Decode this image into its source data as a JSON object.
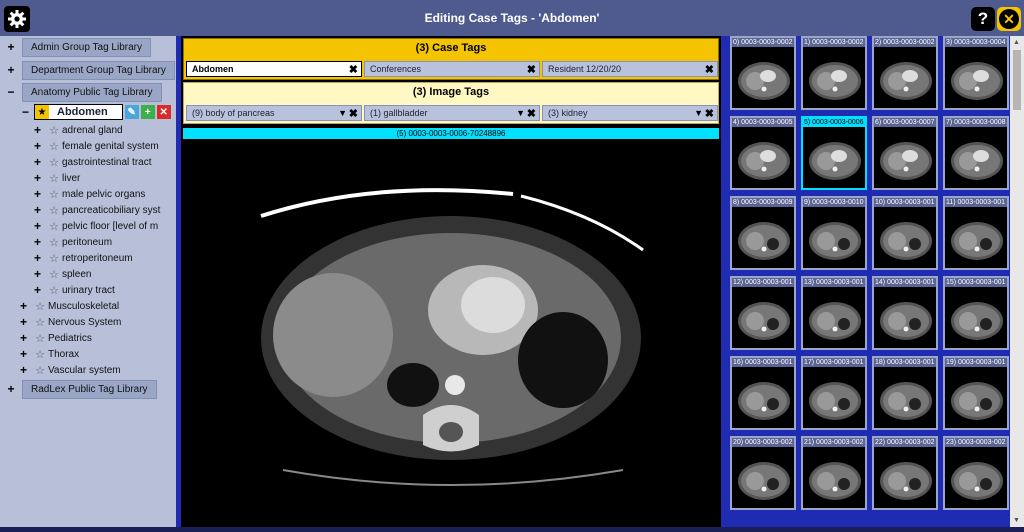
{
  "window": {
    "title": "Editing Case Tags - 'Abdomen'",
    "help_label": "?",
    "close_label": "✕"
  },
  "sidebar": {
    "libraries": [
      {
        "label": "Admin Group Tag Library",
        "toggle": "+"
      },
      {
        "label": "Department Group Tag Library",
        "toggle": "+"
      },
      {
        "label": "Anatomy Public Tag Library",
        "toggle": "−"
      },
      {
        "label": "RadLex Public Tag Library",
        "toggle": "+"
      }
    ],
    "selected_node": "Abdomen",
    "abdomen_children": [
      "adrenal gland",
      "female genital system",
      "gastrointestinal tract",
      "liver",
      "male pelvic organs",
      "pancreaticobiliary syst",
      "pelvic floor [level of m",
      "peritoneum",
      "retroperitoneum",
      "spleen",
      "urinary tract"
    ],
    "top_nodes": [
      "Musculoskeletal",
      "Nervous System",
      "Pediatrics",
      "Thorax",
      "Vascular system"
    ]
  },
  "case_tags": {
    "title": "(3) Case Tags",
    "tags": [
      "Abdomen",
      "Conferences",
      "Resident 12/20/20"
    ]
  },
  "image_tags": {
    "title": "(3) Image Tags",
    "tags": [
      "(9) body of pancreas",
      "(1) gallbladder",
      "(3) kidney"
    ]
  },
  "viewer": {
    "caption": "(5) 0003-0003-0006-70248896"
  },
  "thumbnails": {
    "selected_index": 5,
    "labels": [
      "0) 0003-0003-0002",
      "1) 0003-0003-0002",
      "2) 0003-0003-0002",
      "3) 0003-0003-0004",
      "4) 0003-0003-0005",
      "5) 0003-0003-0006",
      "6) 0003-0003-0007",
      "7) 0003-0003-0008",
      "8) 0003-0003-0009",
      "9) 0003-0003-0010",
      "10) 0003-0003-001",
      "11) 0003-0003-001",
      "12) 0003-0003-001",
      "13) 0003-0003-001",
      "14) 0003-0003-001",
      "15) 0003-0003-001",
      "16) 0003-0003-001",
      "17) 0003-0003-001",
      "18) 0003-0003-001",
      "19) 0003-0003-001",
      "20) 0003-0003-002",
      "21) 0003-0003-002",
      "22) 0003-0003-002",
      "23) 0003-0003-002"
    ]
  },
  "colors": {
    "title_bar": "#4f5b8e",
    "case_tags": "#f5c400",
    "image_tags": "#fff8c2",
    "accent": "#00e0ff"
  }
}
